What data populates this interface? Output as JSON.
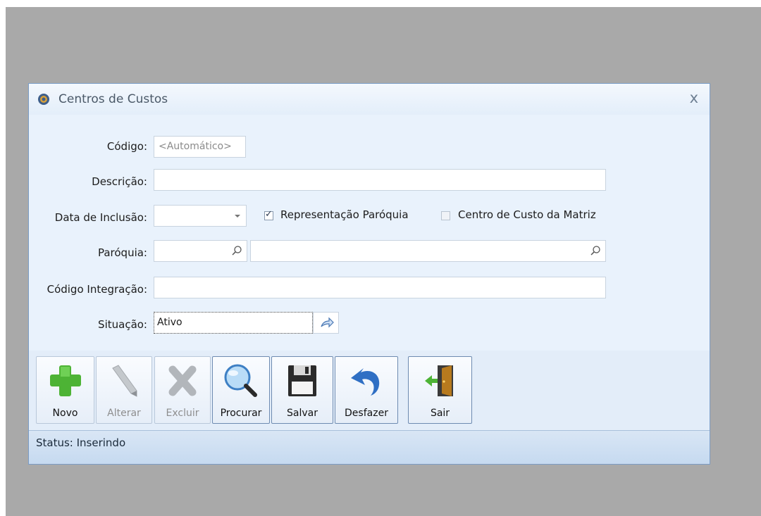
{
  "window": {
    "title": "Centros de Custos",
    "close_glyph": "x"
  },
  "form": {
    "codigo": {
      "label": "Código:",
      "value": "<Automático>"
    },
    "descricao": {
      "label": "Descrição:",
      "value": ""
    },
    "data_inclusao": {
      "label": "Data de Inclusão:",
      "value": ""
    },
    "representacao_paroquia": {
      "label": "Representação Paróquia",
      "checked": true
    },
    "centro_custo_matriz": {
      "label": "Centro de Custo da Matriz",
      "checked": false
    },
    "paroquia": {
      "label": "Paróquia:",
      "code": "",
      "name": ""
    },
    "codigo_integracao": {
      "label": "Código Integração:",
      "value": ""
    },
    "situacao": {
      "label": "Situação:",
      "value": "Ativo"
    }
  },
  "toolbar": {
    "buttons": [
      {
        "label": "Novo",
        "icon": "plus-icon",
        "enabled": true
      },
      {
        "label": "Alterar",
        "icon": "pencil-icon",
        "enabled": false
      },
      {
        "label": "Excluir",
        "icon": "delete-x-icon",
        "enabled": false
      },
      {
        "label": "Procurar",
        "icon": "magnifier-icon",
        "enabled": true
      },
      {
        "label": "Salvar",
        "icon": "floppy-disk-icon",
        "enabled": true
      },
      {
        "label": "Desfazer",
        "icon": "undo-arrow-icon",
        "enabled": true
      },
      {
        "label": "Sair",
        "icon": "exit-door-icon",
        "enabled": true
      }
    ]
  },
  "status": {
    "text": "Status: Inserindo"
  },
  "colors": {
    "window_bg": "#e8f1fb",
    "status_bg": "#c6daf0",
    "border": "#7a9cc6"
  }
}
